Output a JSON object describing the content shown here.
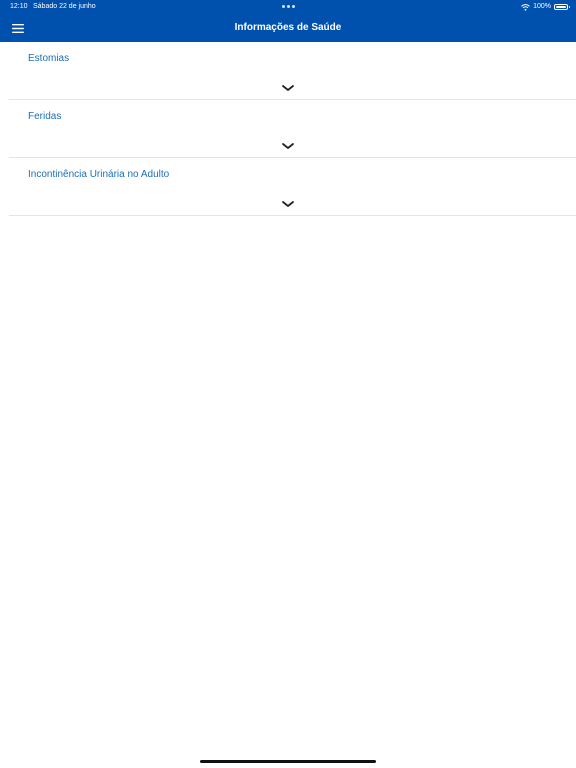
{
  "status_bar": {
    "time": "12:10",
    "date": "Sábado 22 de junho",
    "battery": "100%",
    "icons": [
      "multitask-dots-icon",
      "wifi-icon",
      "battery-icon"
    ]
  },
  "header": {
    "title": "Informações de Saúde",
    "menu_icon": "hamburger-menu-icon",
    "background_color": "#0050ad",
    "text_color": "#ffffff"
  },
  "sections": [
    {
      "title": "Estomias",
      "expand_icon": "chevron-down-icon"
    },
    {
      "title": "Feridas",
      "expand_icon": "chevron-down-icon"
    },
    {
      "title": "Incontinência Urinária no Adulto",
      "expand_icon": "chevron-down-icon"
    }
  ],
  "colors": {
    "section_title": "#1c6fb8",
    "divider": "#e4e4e4",
    "chevron": "#222222"
  }
}
